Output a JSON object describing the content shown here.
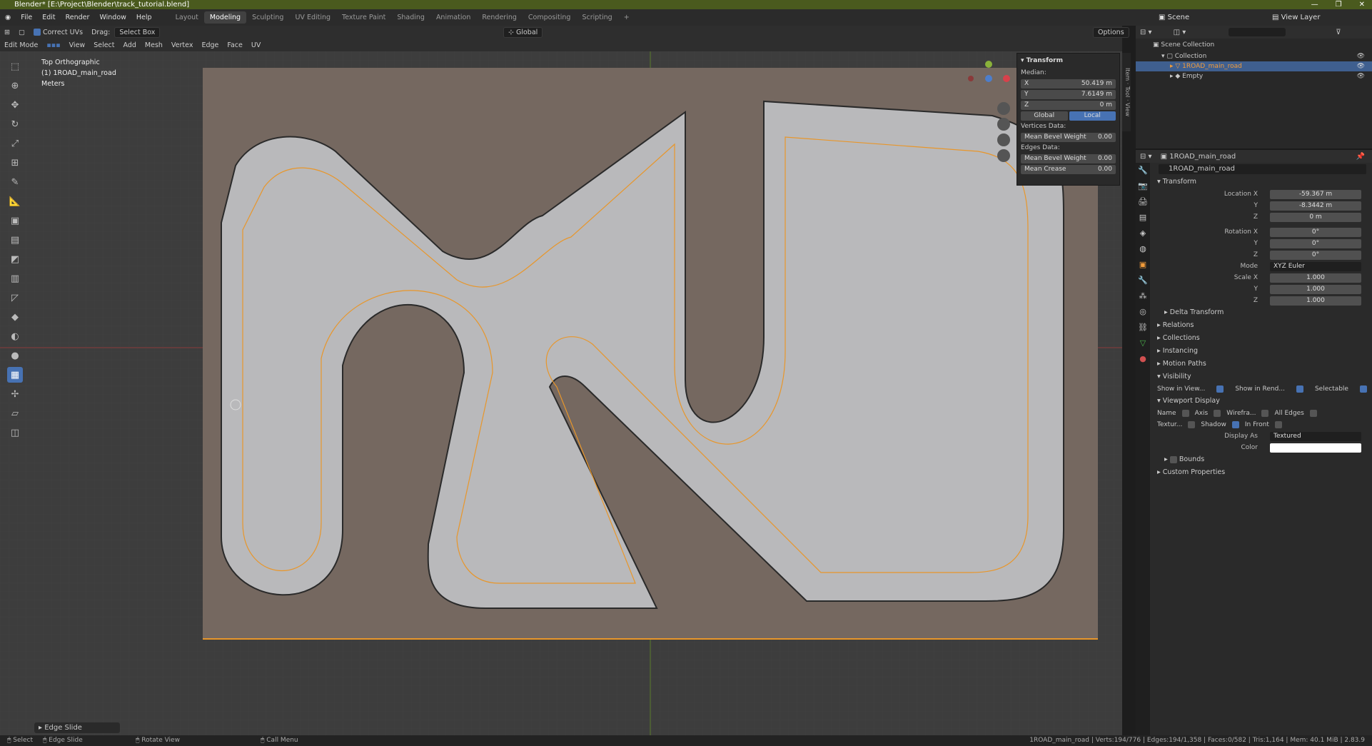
{
  "title": "Blender* [E:\\Project\\Blender\\track_tutorial.blend]",
  "menus": [
    "File",
    "Edit",
    "Render",
    "Window",
    "Help"
  ],
  "workspaces": [
    "Layout",
    "Modeling",
    "Sculpting",
    "UV Editing",
    "Texture Paint",
    "Shading",
    "Animation",
    "Rendering",
    "Compositing",
    "Scripting"
  ],
  "active_workspace": "Modeling",
  "header": {
    "mode": "Edit Mode",
    "correct_uvs": "Correct UVs",
    "drag_label": "Drag:",
    "select_box": "Select Box",
    "orientation": "Global",
    "options": "Options",
    "menu": [
      "View",
      "Select",
      "Add",
      "Mesh",
      "Vertex",
      "Edge",
      "Face",
      "UV"
    ]
  },
  "viewport": {
    "view_name": "Top Orthographic",
    "object": "(1) 1ROAD_main_road",
    "units": "Meters",
    "operator_panel": "Edge Slide"
  },
  "npanel": {
    "title": "Transform",
    "median": "Median:",
    "x": "50.419 m",
    "y": "7.6149 m",
    "z": "0 m",
    "global": "Global",
    "local": "Local",
    "vertices_data": "Vertices Data:",
    "mean_bevel_weight_label": "Mean Bevel Weight",
    "vert_bevel": "0.00",
    "edges_data": "Edges Data:",
    "edge_bevel": "0.00",
    "mean_crease_label": "Mean Crease",
    "mean_crease": "0.00",
    "tabs": [
      "Item",
      "Tool",
      "View"
    ]
  },
  "outliner": {
    "scene": "Scene",
    "view_layer": "View Layer",
    "scene_collection": "Scene Collection",
    "collection": "Collection",
    "object": "1ROAD_main_road",
    "empty": "Empty"
  },
  "properties": {
    "object_name": "1ROAD_main_road",
    "transform": "Transform",
    "location_x": "-59.367 m",
    "location_y": "-8.3442 m",
    "location_z": "0 m",
    "rotation_x": "0°",
    "rotation_y": "0°",
    "rotation_z": "0°",
    "mode": "XYZ Euler",
    "scale_x": "1.000",
    "scale_y": "1.000",
    "scale_z": "1.000",
    "sections": [
      "Delta Transform",
      "Relations",
      "Collections",
      "Instancing",
      "Motion Paths",
      "Visibility"
    ],
    "show_in_viewports": "Show in View...",
    "show_in_renders": "Show in Rend...",
    "selectable": "Selectable",
    "viewport_display": "Viewport Display",
    "name": "Name",
    "axis": "Axis",
    "wireframe": "Wirefra...",
    "all_edges": "All Edges",
    "texture_space": "Textur...",
    "shadow": "Shadow",
    "in_front": "In Front",
    "display_as": "Display As",
    "display_as_value": "Textured",
    "color": "Color",
    "bounds": "Bounds",
    "custom_properties": "Custom Properties",
    "labels": {
      "location": "Location X",
      "rotation": "Rotation X",
      "scale": "Scale X",
      "mode": "Mode"
    }
  },
  "status": {
    "select": "Select",
    "edge_slide": "Edge Slide",
    "rotate_view": "Rotate View",
    "call_menu": "Call Menu",
    "stats": "1ROAD_main_road | Verts:194/776 | Edges:194/1,358 | Faces:0/582 | Tris:1,164 | Mem: 40.1 MiB | 2.83.9"
  },
  "colors": {
    "accent": "#4772b3",
    "title_bar": "#4a5a1e",
    "road": "#b9b9bb",
    "selected_edge": "#e8962a"
  }
}
